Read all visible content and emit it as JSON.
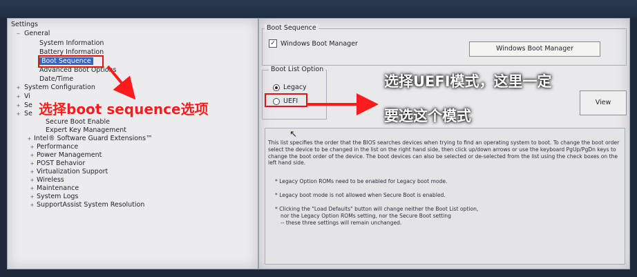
{
  "tree": {
    "items": [
      {
        "label": "Settings",
        "expander": ""
      },
      {
        "label": "General",
        "expander": "−"
      },
      {
        "label": "System Information",
        "expander": ""
      },
      {
        "label": "Battery Information",
        "expander": ""
      },
      {
        "label": "Boot Sequence",
        "expander": "",
        "selected": true
      },
      {
        "label": "Advanced Boot Options",
        "expander": ""
      },
      {
        "label": "Date/Time",
        "expander": ""
      },
      {
        "label": "System Configuration",
        "expander": "+"
      },
      {
        "label": "Vi",
        "expander": "+"
      },
      {
        "label": "Se",
        "expander": "+"
      },
      {
        "label": "Se",
        "expander": "+"
      },
      {
        "label": "Secure Boot Enable",
        "expander": ""
      },
      {
        "label": "Expert Key Management",
        "expander": ""
      },
      {
        "label": "Intel® Software Guard Extensions™",
        "expander": "+"
      },
      {
        "label": "Performance",
        "expander": "+"
      },
      {
        "label": "Power Management",
        "expander": "+"
      },
      {
        "label": "POST Behavior",
        "expander": "+"
      },
      {
        "label": "Virtualization Support",
        "expander": "+"
      },
      {
        "label": "Wireless",
        "expander": "+"
      },
      {
        "label": "Maintenance",
        "expander": "+"
      },
      {
        "label": "System Logs",
        "expander": "+"
      },
      {
        "label": "SupportAssist System Resolution",
        "expander": "+"
      }
    ]
  },
  "boot_sequence": {
    "title": "Boot Sequence",
    "entry_label": "Windows Boot Manager",
    "entry_checked": "✓",
    "button_label": "Windows Boot Manager"
  },
  "boot_list_option": {
    "title": "Boot List Option",
    "options": [
      {
        "label": "Legacy",
        "checked": true
      },
      {
        "label": "UEFI",
        "checked": false
      }
    ]
  },
  "buttons": {
    "view": "View"
  },
  "help": {
    "paragraph": "This list specifies the order that the BIOS searches devices when trying to find an operating system to boot. To change the boot order select the device to be changed in the list on the right hand side, then click up/down arrows or use the keyboard PgUp/PgDn keys to change the boot order of the device. The boot devices can also be selected or de-selected from the list using the check boxes on the left hand side.",
    "bullet1": "* Legacy Option ROMs need to be enabled for Legacy boot mode.",
    "bullet2": "* Legacy boot mode is not allowed when Secure Boot is enabled.",
    "bullet3_line1": "* Clicking the \"Load Defaults\" button will change neither the Boot List option,",
    "bullet3_line2": "nor the Legacy Option ROMs setting, nor the Secure Boot setting",
    "bullet3_line3": "-- these three settings will remain unchanged."
  },
  "annotations": {
    "left": "选择boot sequence选项",
    "right_line1": "选择UEFI模式，这里一定",
    "right_line2": "要选这个模式",
    "color": "#ff1b1b"
  },
  "colors": {
    "selection": "#2f68c8",
    "annotation_box": "#e01212"
  }
}
